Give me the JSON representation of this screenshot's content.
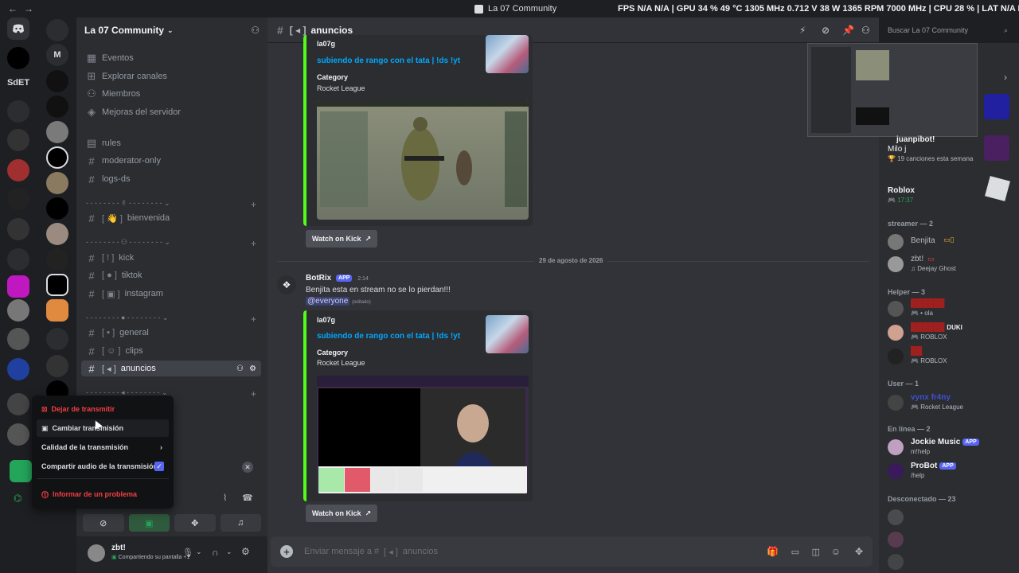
{
  "titlebar": {
    "title": "La 07 Community",
    "stats": "FPS N/A N/A | GPU 34 % 49 °C 1305 MHz 0.712 V 38 W 1365 RPM 7000 MHz | CPU 28 % | LAT N/A N/A"
  },
  "rail": {
    "labels": [
      "M",
      "SdET"
    ]
  },
  "server": {
    "name": "La 07 Community",
    "top_items": [
      "Eventos",
      "Explorar canales",
      "Miembros",
      "Mejoras del servidor"
    ],
    "channels_a": [
      "rules",
      "moderator-only",
      "logs-ds"
    ],
    "channels_b": [
      "bienvenida"
    ],
    "channels_c": [
      "kick",
      "tiktok",
      "instagram"
    ],
    "channels_d": [
      "general",
      "clips",
      "anuncios"
    ]
  },
  "context_menu": {
    "stop": "Dejar de transmitir",
    "change": "Cambiar transmisión",
    "quality": "Calidad de la transmisión",
    "share_audio": "Compartir audio de la transmisión",
    "report": "Informar de un problema"
  },
  "user_panel": {
    "name": "zbt!",
    "status": "Compartiendo su pantalla +1"
  },
  "chat": {
    "channel": "anuncios",
    "search_placeholder": "Buscar La 07 Community",
    "date_divider": "29 de agosto de 2026",
    "embed1": {
      "author": "la07g",
      "title": "subiendo de rango con el tata | !ds !yt",
      "field_name": "Category",
      "field_value": "Rocket League",
      "button": "Watch on Kick"
    },
    "message": {
      "author": "BotRix",
      "tag": "APP",
      "time": "2:14",
      "text": "Benjita esta en stream no se lo pierdan!!!",
      "mention": "@everyone",
      "edited": "(editado)"
    },
    "embed2": {
      "author": "la07g",
      "title": "subiendo de rango con el tata | !ds !yt",
      "field_name": "Category",
      "field_value": "Rocket League",
      "button": "Watch on Kick"
    },
    "input_placeholder": "Enviar mensaje a #",
    "input_channel": "anuncios"
  },
  "members": {
    "activity1_name": "juanpibot!",
    "activity1_song": "Milo j",
    "activity1_sub": "19 canciones esta semana",
    "activity2_name": "Roblox",
    "activity2_time": "17:37",
    "cat_streamer": "streamer — 2",
    "streamer1": "Benjita",
    "streamer2": "zbt!",
    "streamer2_status": "Deejay Ghost",
    "cat_helper": "Helper — 3",
    "helper1_status": "ola",
    "helper2_badge": "DUKI",
    "helper2_status": "ROBLOX",
    "helper3_status": "ROBLOX",
    "cat_user": "User — 1",
    "user1": "vynx fr4ny",
    "user1_status": "Rocket League",
    "cat_online": "En línea — 2",
    "online1": "Jockie Music",
    "online1_status": "m!help",
    "online2": "ProBot",
    "online2_status": "/help",
    "bot_tag": "APP",
    "cat_offline": "Desconectado — 23"
  },
  "colors": {
    "accent": "#5865f2",
    "kick_green": "#53fc18",
    "danger": "#f23f43",
    "link": "#00a8fc"
  }
}
